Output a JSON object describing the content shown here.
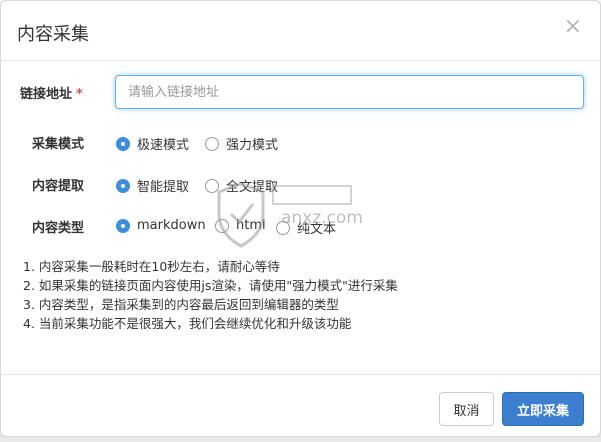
{
  "dialog": {
    "title": "内容采集",
    "close_symbol": "×",
    "url_field": {
      "label": "链接地址",
      "required_mark": "*",
      "placeholder": "请输入链接地址",
      "value": ""
    },
    "mode": {
      "label": "采集模式",
      "options": [
        {
          "text": "极速模式",
          "selected": true
        },
        {
          "text": "强力模式",
          "selected": false
        }
      ]
    },
    "extract": {
      "label": "内容提取",
      "options": [
        {
          "text": "智能提取",
          "selected": true
        },
        {
          "text": "全文提取",
          "selected": false
        }
      ]
    },
    "content_type": {
      "label": "内容类型",
      "options": [
        {
          "text": "markdown",
          "selected": true
        },
        {
          "text": "html",
          "selected": false
        },
        {
          "text": "纯文本",
          "selected": false
        }
      ]
    },
    "notes": [
      "1. 内容采集一般耗时在10秒左右，请耐心等待",
      "2. 如果采集的链接页面内容使用js渲染，请使用\"强力模式\"进行采集",
      "3. 内容类型，是指采集到的内容最后返回到编辑器的类型",
      "4. 当前采集功能不是很强大，我们会继续优化和升级该功能"
    ],
    "footer": {
      "cancel_label": "取消",
      "submit_label": "立即采集"
    }
  },
  "watermark": {
    "text": "anxz.com"
  },
  "colors": {
    "accent": "#3c8dde",
    "primary_button": "#3c7fcf",
    "required": "#d9534f",
    "input_focus": "#66afe9"
  }
}
